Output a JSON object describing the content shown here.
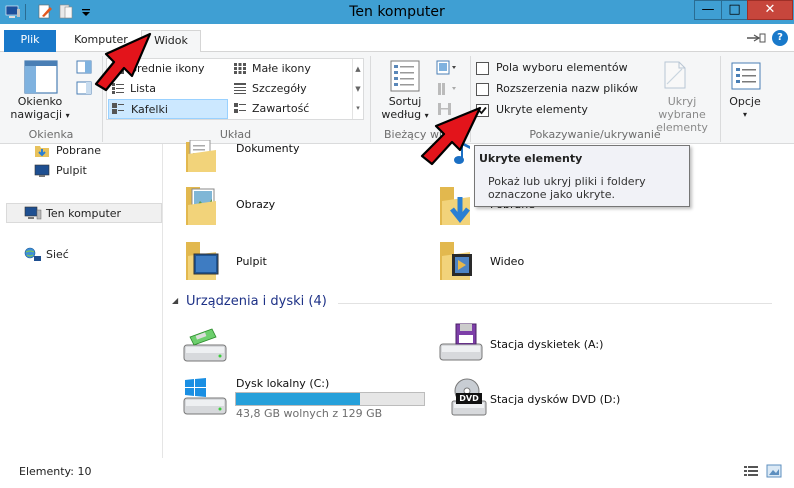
{
  "window": {
    "title": "Ten komputer",
    "minimize_glyph": "—",
    "maximize_glyph": "□",
    "close_glyph": "✕"
  },
  "tabs": {
    "file": "Plik",
    "computer": "Komputer",
    "view": "Widok",
    "help_glyph": "?"
  },
  "ribbon": {
    "panes": {
      "nav_pane_label": "Okienko",
      "nav_pane_label_line2": "nawigacji",
      "group": "Okienka"
    },
    "layout": {
      "items": [
        "Średnie ikony",
        "Małe ikony",
        "Lista",
        "Szczegóły",
        "Kafelki",
        "Zawartość"
      ],
      "group": "Układ"
    },
    "current_view": {
      "sort_label": "Sortuj",
      "sort_label_line2": "według",
      "group": "Bieżący wid"
    },
    "show_hide": {
      "item_checkboxes": "Pola wyboru elementów",
      "file_extensions": "Rozszerzenia nazw plików",
      "hidden_items": "Ukryte elementy",
      "hide_selected": "Ukryj wybrane",
      "hide_selected_line2": "elementy",
      "group": "Pokazywanie/ukrywanie",
      "item_checkboxes_checked": false,
      "file_extensions_checked": false,
      "hidden_items_checked": true
    },
    "options": {
      "label": "Opcje"
    }
  },
  "tooltip": {
    "title": "Ukryte elementy",
    "body": "Pokaż lub ukryj pliki i foldery",
    "body_line2": "oznaczone jako ukryte."
  },
  "nav": {
    "items": [
      "Pobrane",
      "Pulpit",
      "Ten komputer",
      "Sieć"
    ]
  },
  "folders": {
    "items": [
      "Dokumenty",
      "Obrazy",
      "Pulpit",
      "Wideo"
    ],
    "items_right": [
      "Pobrane"
    ]
  },
  "devices": {
    "header": "Urządzenia i dyski (4)",
    "local_disk": {
      "name": "Dysk lokalny (C:)",
      "free_text": "43,8 GB wolnych z 129 GB",
      "used_fraction": 0.66
    },
    "floppy": "Stacja dyskietek (A:)",
    "dvd": "Stacja dysków DVD (D:)",
    "dvd_badge": "DVD"
  },
  "status": {
    "items": "Elementy: 10"
  },
  "colors": {
    "titlebar": "#3f9fd3",
    "file_tab": "#1979ca",
    "accent_text": "#1e3287",
    "progress": "#26a0da",
    "arrow": "#e3141b"
  }
}
